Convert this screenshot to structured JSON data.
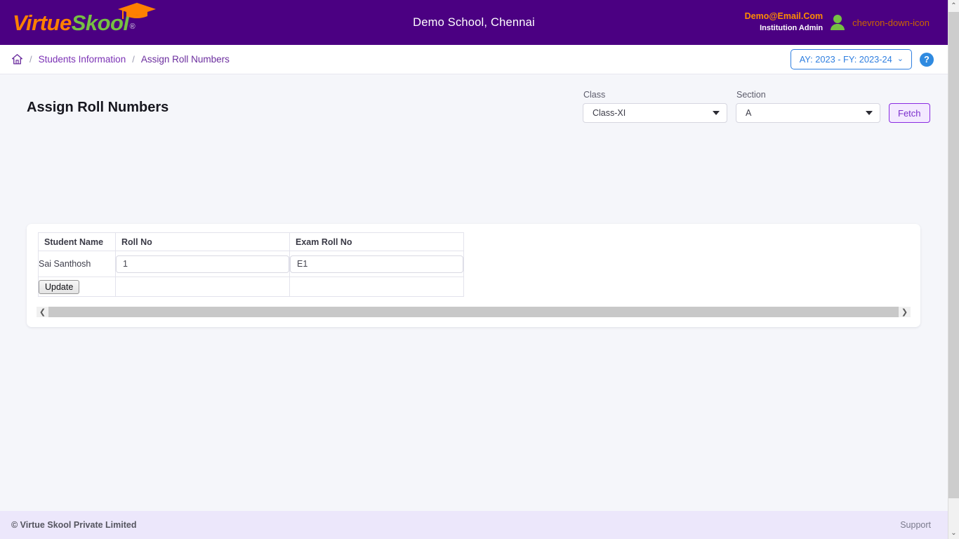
{
  "brand": {
    "logo_part1": "Virtue",
    "logo_part2": "Skool",
    "logo_registered": "®",
    "cap_icon": "graduation-cap-icon",
    "orange": "#ff8000",
    "green": "#76c043",
    "header_purple": "#4b0082"
  },
  "header": {
    "school_title": "Demo School, Chennai",
    "user_email": "Demo@Email.Com",
    "user_role": "Institution Admin",
    "avatar_icon": "user-avatar-icon",
    "caret_icon": "chevron-down-icon"
  },
  "breadcrumb": {
    "home_icon": "home-icon",
    "separator": "/",
    "items": [
      {
        "label": "Students Information"
      },
      {
        "label": "Assign Roll Numbers"
      }
    ],
    "academic_year": "AY: 2023 - FY: 2023-24",
    "ay_caret": "⌄",
    "help_label": "?"
  },
  "main": {
    "page_title": "Assign Roll Numbers",
    "filters": {
      "class": {
        "label": "Class",
        "value": "Class-XI"
      },
      "section": {
        "label": "Section",
        "value": "A"
      },
      "fetch_label": "Fetch"
    },
    "table": {
      "columns": [
        "Student Name",
        "Roll No",
        "Exam Roll No"
      ],
      "rows": [
        {
          "student_name": "Sai Santhosh",
          "roll_no": "1",
          "exam_roll_no": "E1"
        }
      ],
      "update_label": "Update",
      "scroll_left_icon": "❮",
      "scroll_right_icon": "❯"
    }
  },
  "footer": {
    "copyright": "© Virtue Skool Private Limited",
    "support": "Support"
  },
  "scrollbar": {
    "up_icon": "⌃",
    "down_icon": "⌄"
  }
}
